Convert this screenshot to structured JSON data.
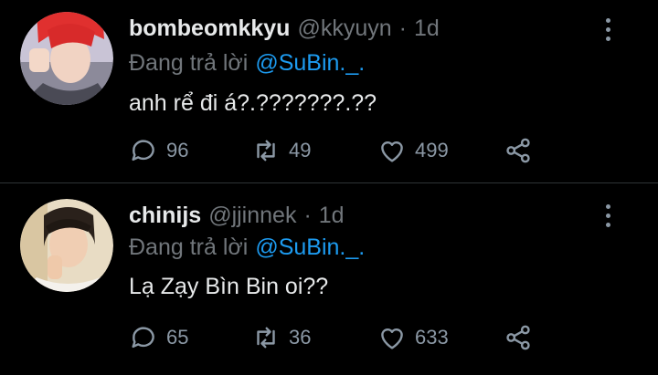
{
  "tweets": [
    {
      "name": "bombeomkkyu",
      "handle": "@kkyuyn",
      "separator": "·",
      "time": "1d",
      "reply_prefix": "Đang trả lời",
      "reply_to": "@SuBin._.",
      "text": "anh rể đi á?.???????.??",
      "replies": "96",
      "retweets": "49",
      "likes": "499"
    },
    {
      "name": "chinijs",
      "handle": "@jjinnek",
      "separator": "·",
      "time": "1d",
      "reply_prefix": "Đang trả lời",
      "reply_to": "@SuBin._.",
      "text": "Lạ Zạy Bìn Bin oi??",
      "replies": "65",
      "retweets": "36",
      "likes": "633"
    }
  ],
  "colors": {
    "background": "#000000",
    "text": "#e7e9ea",
    "secondary": "#71767b",
    "accent": "#1d9bf0",
    "divider": "#2f3336"
  }
}
